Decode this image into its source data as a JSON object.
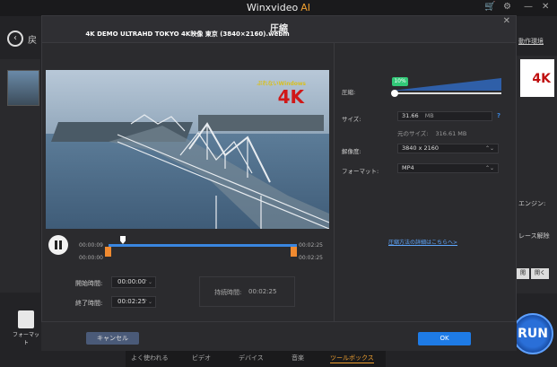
{
  "app": {
    "title": "Winxvideo",
    "title_ai": "AI",
    "back_label": "戻",
    "right_link": "動作環境",
    "format_label": "フォーマット",
    "run_label": "RUN",
    "right_texts": [
      "エンジン:",
      "レース解除"
    ],
    "right_buttons": [
      "閲",
      "開く"
    ],
    "bottom_tabs": [
      "よく使われる",
      "ビデオ",
      "デバイス",
      "音楽",
      "ツールボックス"
    ]
  },
  "dialog": {
    "title": "圧縮",
    "close_glyph": "✕",
    "video_title": "4K DEMO ULTRAHD TOKYO 4K映像 東京 (3840×2160).webm",
    "watermark_text": "ぶれないWindows",
    "watermark_4k": "4K",
    "timeline": {
      "current": "00:00:09",
      "start": "00:00:00",
      "end": "00:02:25",
      "end_below": "00:02:25",
      "progress_fraction": 0.06
    },
    "start_time_label": "開始時間:",
    "start_time_value": "00:00:00",
    "end_time_label": "終了時間:",
    "end_time_value": "00:02:25",
    "duration_label": "持続時間:",
    "duration_value": "00:02:25",
    "compression_label": "圧縮:",
    "compression_percent": "10%",
    "compression_fraction": 0.1,
    "size_label": "サイズ:",
    "size_value": "31.66",
    "size_unit": "MB",
    "help_glyph": "?",
    "original_size_label": "元のサイズ:",
    "original_size_value": "316.61 MB",
    "resolution_label": "解像度:",
    "resolution_value": "3840 x 2160",
    "format_label": "フォーマット:",
    "format_value": "MP4",
    "detail_link": "圧縮方法の詳細はこちらへ>",
    "cancel_label": "キャンセル",
    "ok_label": "OK"
  },
  "colors": {
    "accent_blue": "#1e7be6",
    "badge_green": "#32c878",
    "handle_orange": "#f08a30"
  }
}
